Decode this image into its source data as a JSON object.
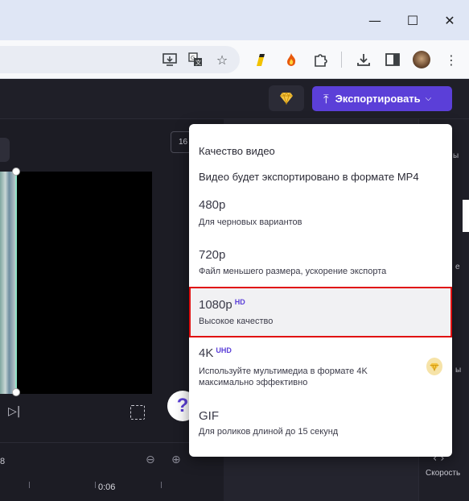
{
  "browser": {
    "window_controls": {
      "minimize": "—",
      "maximize": "☐",
      "close": "✕"
    },
    "toolbar_icons": [
      "install-app-icon",
      "translate-icon",
      "bookmark-star-icon",
      "extension-i-icon",
      "extension-flame-icon",
      "extensions-puzzle-icon",
      "downloads-icon",
      "sidebar-icon",
      "profile-avatar"
    ]
  },
  "app": {
    "export_button": {
      "label": "Экспортировать"
    },
    "aspect_ratio_label": "16",
    "timeline": {
      "time_left": "8",
      "time_mark": "0:06"
    },
    "right_rail": {
      "item_top": "ы",
      "item_mid": "е",
      "item_low": "ы",
      "speed_label": "Скорость"
    }
  },
  "dropdown": {
    "title": "Качество видео",
    "subtitle": "Видео будет экспортировано в формате MP4",
    "options": [
      {
        "title": "480p",
        "badge": "",
        "description": "Для черновых вариантов"
      },
      {
        "title": "720p",
        "badge": "",
        "description": "Файл меньшего размера, ускорение экспорта"
      },
      {
        "title": "1080p",
        "badge": "HD",
        "description": "Высокое качество"
      },
      {
        "title": "4K",
        "badge": "UHD",
        "description_line1": "Используйте мультимедиа в формате 4K",
        "description_line2": "максимально эффективно"
      },
      {
        "title": "GIF",
        "badge": "",
        "description": "Для роликов длиной до 15 секунд"
      }
    ]
  },
  "colors": {
    "accent": "#5b3fd8",
    "highlight_border": "#e01010",
    "premium_gem": "#f5c542"
  }
}
